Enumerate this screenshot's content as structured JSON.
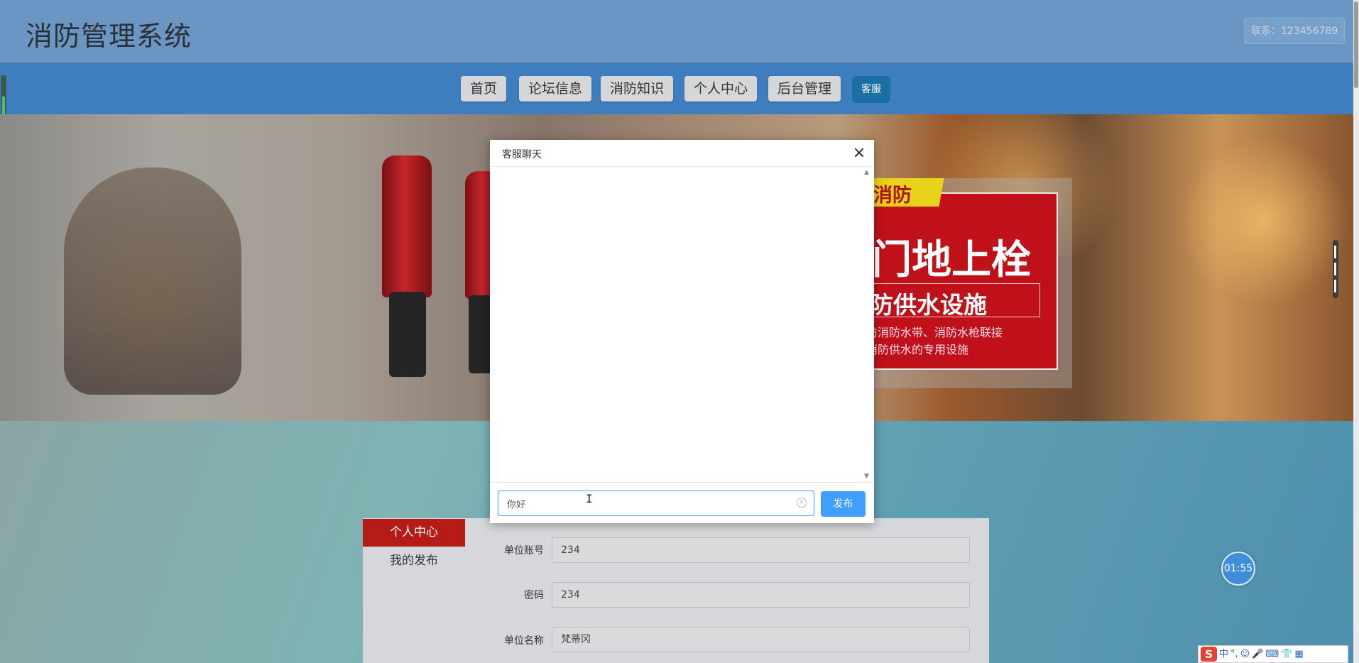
{
  "app": {
    "title": "消防管理系统",
    "contact": "联系：123456789"
  },
  "nav": {
    "items": [
      {
        "label": "首页"
      },
      {
        "label": "论坛信息"
      },
      {
        "label": "消防知识"
      },
      {
        "label": "个人中心"
      },
      {
        "label": "后台管理"
      }
    ],
    "kefu": "客服"
  },
  "banner": {
    "tag": "消防",
    "headline": "门地上栓",
    "subline": "防供水设施",
    "line1": "防消防水带、消防水枪联接",
    "line2": "消防供水的专用设施"
  },
  "sidebar": {
    "active": "个人中心",
    "items": [
      {
        "label": "我的发布"
      }
    ]
  },
  "form": {
    "fields": [
      {
        "label": "单位账号",
        "value": "234"
      },
      {
        "label": "密码",
        "value": "234"
      },
      {
        "label": "单位名称",
        "value": "梵蒂冈"
      }
    ]
  },
  "modal": {
    "title": "客服聊天",
    "close": "×",
    "input_value": "你好",
    "publish": "发布"
  },
  "timer": "01:55",
  "ime": {
    "logo": "S",
    "icons": [
      "中",
      "°,",
      "☺",
      "🎤",
      "⌨",
      "👕",
      "▦"
    ]
  },
  "colors": {
    "nav_bg": "#3e7dbe",
    "header_bg": "#6b95c3",
    "primary": "#409eff",
    "active_red": "#b51c17"
  }
}
